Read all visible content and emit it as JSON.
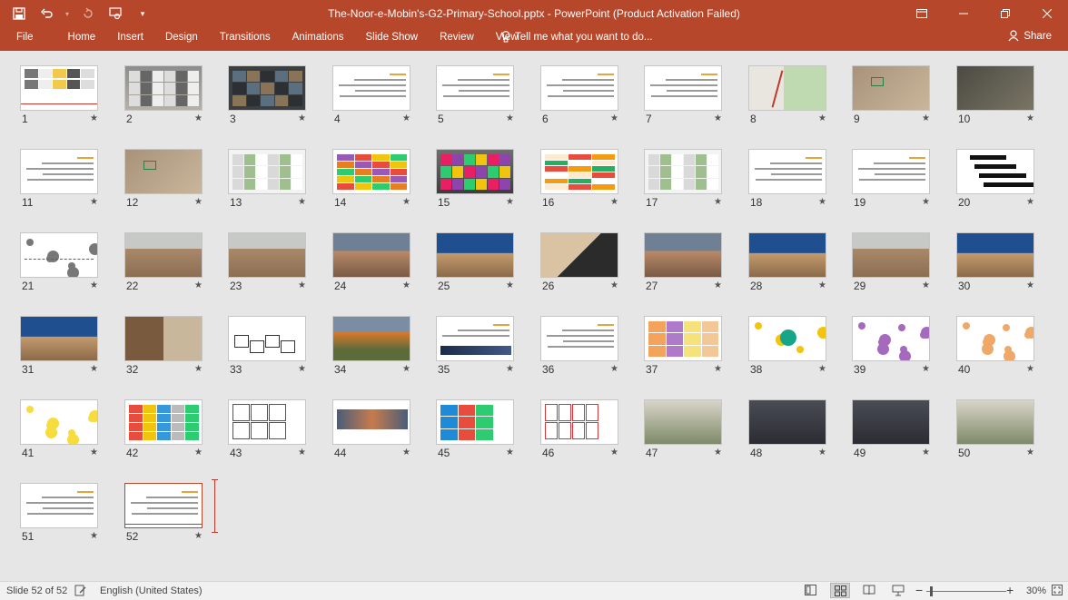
{
  "window": {
    "title": "The-Noor-e-Mobin's-G2-Primary-School.pptx - PowerPoint (Product Activation Failed)"
  },
  "quick_access": [
    "save-icon",
    "undo-icon",
    "redo-icon",
    "touch-mode-icon",
    "customize-icon"
  ],
  "ribbon": {
    "tabs": [
      "File",
      "Home",
      "Insert",
      "Design",
      "Transitions",
      "Animations",
      "Slide Show",
      "Review",
      "View"
    ],
    "tell_me": "Tell me what you want to do...",
    "share": "Share"
  },
  "slides": [
    {
      "n": "1",
      "kind": "title"
    },
    {
      "n": "2",
      "kind": "aerial"
    },
    {
      "n": "3",
      "kind": "dark-aerial"
    },
    {
      "n": "4",
      "kind": "text"
    },
    {
      "n": "5",
      "kind": "text"
    },
    {
      "n": "6",
      "kind": "text"
    },
    {
      "n": "7",
      "kind": "text"
    },
    {
      "n": "8",
      "kind": "map"
    },
    {
      "n": "9",
      "kind": "sat"
    },
    {
      "n": "10",
      "kind": "sat-dark"
    },
    {
      "n": "11",
      "kind": "text"
    },
    {
      "n": "12",
      "kind": "sat"
    },
    {
      "n": "13",
      "kind": "model"
    },
    {
      "n": "14",
      "kind": "grid-color"
    },
    {
      "n": "15",
      "kind": "color-3d"
    },
    {
      "n": "16",
      "kind": "table"
    },
    {
      "n": "17",
      "kind": "model"
    },
    {
      "n": "18",
      "kind": "text"
    },
    {
      "n": "19",
      "kind": "text"
    },
    {
      "n": "20",
      "kind": "black-bars"
    },
    {
      "n": "21",
      "kind": "diagram"
    },
    {
      "n": "22",
      "kind": "landscape"
    },
    {
      "n": "23",
      "kind": "landscape"
    },
    {
      "n": "24",
      "kind": "dusk"
    },
    {
      "n": "25",
      "kind": "blue-sky"
    },
    {
      "n": "26",
      "kind": "shadow"
    },
    {
      "n": "27",
      "kind": "dusk"
    },
    {
      "n": "28",
      "kind": "blue-sky"
    },
    {
      "n": "29",
      "kind": "landscape"
    },
    {
      "n": "30",
      "kind": "blue-sky"
    },
    {
      "n": "31",
      "kind": "blue-sky"
    },
    {
      "n": "32",
      "kind": "photo-mix"
    },
    {
      "n": "33",
      "kind": "sketch"
    },
    {
      "n": "34",
      "kind": "orange"
    },
    {
      "n": "35",
      "kind": "section"
    },
    {
      "n": "36",
      "kind": "text"
    },
    {
      "n": "37",
      "kind": "plan-color"
    },
    {
      "n": "38",
      "kind": "bubbles-teal"
    },
    {
      "n": "39",
      "kind": "bubbles-purple"
    },
    {
      "n": "40",
      "kind": "bubbles-orange"
    },
    {
      "n": "41",
      "kind": "bubbles-yellow"
    },
    {
      "n": "42",
      "kind": "collage"
    },
    {
      "n": "43",
      "kind": "plan-bw"
    },
    {
      "n": "44",
      "kind": "elevation"
    },
    {
      "n": "45",
      "kind": "plan-blue"
    },
    {
      "n": "46",
      "kind": "plan-red"
    },
    {
      "n": "47",
      "kind": "classroom"
    },
    {
      "n": "48",
      "kind": "classroom-dark"
    },
    {
      "n": "49",
      "kind": "classroom-dark"
    },
    {
      "n": "50",
      "kind": "classroom"
    },
    {
      "n": "51",
      "kind": "text"
    },
    {
      "n": "52",
      "kind": "text-last"
    }
  ],
  "status": {
    "slide_indicator": "Slide 52 of 52",
    "language": "English (United States)",
    "zoom": "30%",
    "zoom_minus": "−",
    "zoom_plus": "+"
  },
  "colors": {
    "accent": "#b7472a",
    "background": "#e6e6e6"
  }
}
